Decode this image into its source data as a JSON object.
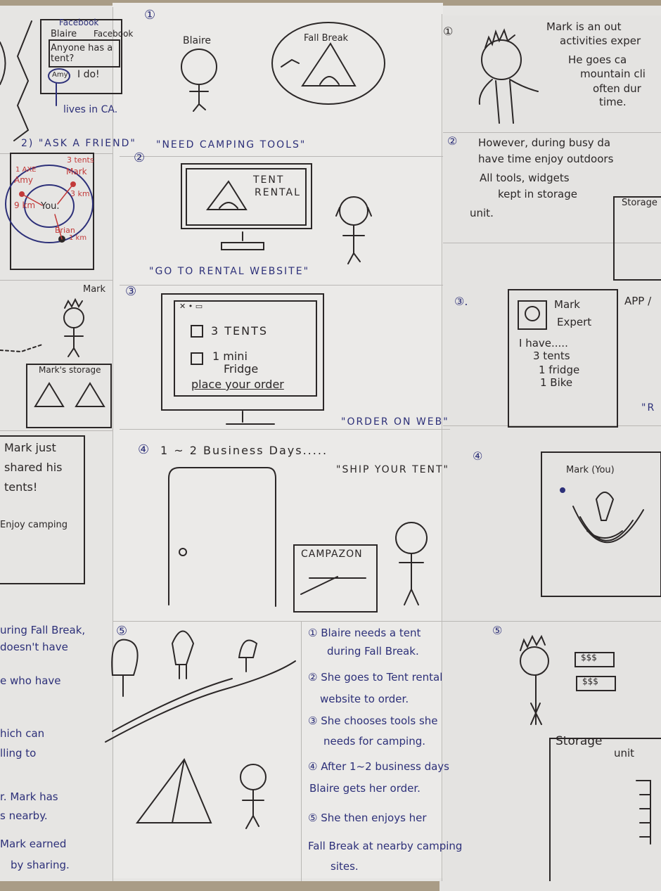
{
  "left_column": {
    "facebook": {
      "window_title": "Facebook",
      "user": "Blaire",
      "brand": "Facebook",
      "post": "Anyone has a tent?",
      "reply_user": "Amy",
      "reply": "I do!",
      "note": "lives in CA."
    },
    "caption_2": "2) \"ASK A FRIEND\"",
    "map": {
      "amy_item": "1 AXE",
      "amy": "Amy",
      "amy_dist": "9 km",
      "mark_item": "3 tents",
      "mark": "Mark",
      "mark_dist": "3 km",
      "you": "You.",
      "brian": "Brian",
      "brian_dist": "1 km"
    },
    "mark_label": "Mark",
    "storage_label": "Mark's storage",
    "phone_message": [
      "Mark just",
      "shared his",
      "tents!",
      "Enjoy camping"
    ],
    "story_fragments": [
      "uring Fall Break,",
      "doesn't have",
      "e who have",
      "hich can",
      "lling to",
      "r. Mark has",
      "s nearby.",
      "Mark earned",
      "by sharing."
    ]
  },
  "middle_column": {
    "panel1": {
      "number": "①",
      "name": "Blaire",
      "bubble": "Fall Break",
      "caption": "\"NEED CAMPING TOOLS\""
    },
    "panel2": {
      "number": "②",
      "screen": [
        "TENT",
        "RENTAL"
      ],
      "caption": "\"GO TO RENTAL WEBSITE\""
    },
    "panel3": {
      "number": "③",
      "item1": "3 TENTS",
      "item2": [
        "1 mini",
        "Fridge"
      ],
      "order": "place your order",
      "caption": "\"ORDER ON WEB\""
    },
    "panel4": {
      "number": "④",
      "title": "1 ~ 2 Business Days.....",
      "caption": "\"SHIP YOUR TENT\"",
      "box_label": "CAMPAZON"
    },
    "panel5": {
      "number": "⑤"
    },
    "steps": [
      [
        "① Blaire needs a tent",
        "during Fall Break."
      ],
      [
        "② She goes to Tent rental",
        "website to order."
      ],
      [
        "③ She chooses tools she",
        "needs for camping."
      ],
      [
        "④ After 1~2 business days",
        "Blaire gets her order."
      ],
      [
        "⑤ She then enjoys her",
        "Fall Break at nearby camping",
        "sites."
      ]
    ]
  },
  "right_column": {
    "panel1": {
      "number": "①",
      "lines": [
        "Mark is an out",
        "activities exper",
        "He goes ca",
        "mountain cli",
        "often dur",
        "time."
      ]
    },
    "panel2": {
      "number": "②",
      "lines": [
        "However, during busy da",
        "have time enjoy outdoors",
        "All tools, widgets",
        "kept in storage",
        "unit."
      ],
      "storage_label": "Storage"
    },
    "panel3": {
      "number": "③.",
      "profile_name": [
        "Mark",
        "Expert"
      ],
      "inventory": [
        "I have.....",
        "3 tents",
        "1 fridge",
        "1 Bike"
      ],
      "side_text": "APP /",
      "caption": "\"R"
    },
    "panel4": {
      "number": "④",
      "map_label": "Mark (You)"
    },
    "panel5": {
      "number": "⑤",
      "money1": "$$$",
      "money2": "$$$",
      "storage": [
        "Storage",
        "unit"
      ]
    }
  },
  "colors": {
    "ink": "#2b2727",
    "blue_ink": "#2d3079",
    "red_ink": "#c23a3a",
    "paper": "#e6e5e3",
    "carpet": "#a99c86"
  }
}
